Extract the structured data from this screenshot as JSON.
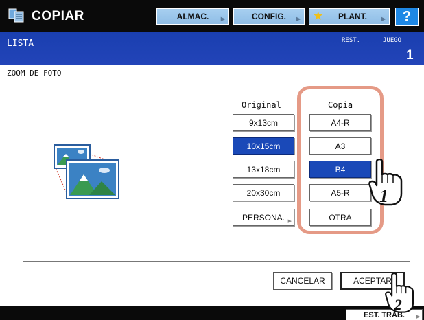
{
  "header": {
    "app_title": "COPIAR",
    "buttons": {
      "almac": "ALMAC.",
      "config": "CONFIG.",
      "plant": "PLANT.",
      "help": "?"
    }
  },
  "status": {
    "text": "LISTA",
    "rest_label": "REST.",
    "juego_label": "JUEGO",
    "juego_value": "1"
  },
  "page": {
    "title": "ZOOM DE FOTO",
    "original_header": "Original",
    "copia_header": "Copia",
    "original_sizes": [
      "9x13cm",
      "10x15cm",
      "13x18cm",
      "20x30cm",
      "PERSONA."
    ],
    "copia_sizes": [
      "A4-R",
      "A3",
      "B4",
      "A5-R",
      "OTRA"
    ],
    "selected_original": "10x15cm",
    "selected_copia": "B4"
  },
  "callouts": {
    "step1": "1",
    "step2": "2"
  },
  "actions": {
    "cancel": "CANCELAR",
    "accept": "ACEPTAR"
  },
  "footer": {
    "est_trab": "EST. TRAB."
  },
  "colors": {
    "accent_blue": "#1a49b8",
    "status_blue": "#1a3fb0",
    "highlight_frame": "#e59a86",
    "help_blue": "#1e88e5"
  }
}
